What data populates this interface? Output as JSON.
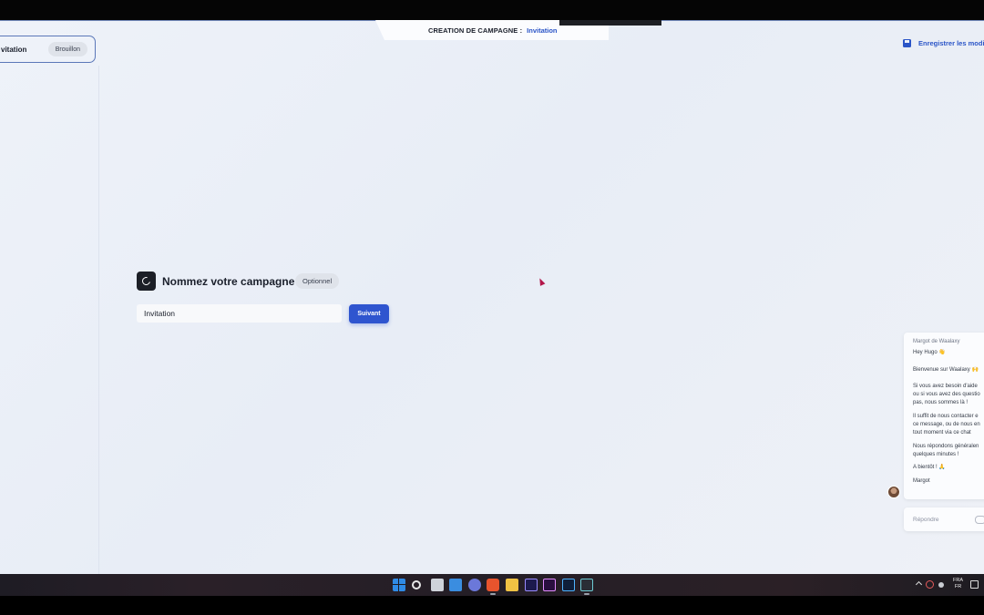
{
  "header": {
    "title_label": "CREATION DE CAMPAGNE :",
    "title_value": "Invitation",
    "save_label": "Enregistrer les modific"
  },
  "sidebar": {
    "campaign_name": "vitation",
    "campaign_status": "Brouillon"
  },
  "main": {
    "heading": "Nommez votre campagne",
    "optional_badge": "Optionnel",
    "name_input_value": "Invitation",
    "next_button": "Suivant"
  },
  "chat": {
    "sender": "Margot de Waalaxy",
    "lines": [
      "Hey Hugo 👋",
      "Bienvenue sur Waalaxy 🙌",
      "Si vous avez besoin d'aide",
      "ou si vous avez des questio",
      "pas, nous sommes là !",
      "Il suffit de nous contacter e",
      "ce message, ou de nous en",
      "tout moment via ce chat",
      "Nous répondons généralen",
      "quelques minutes !",
      "A bientôt ! 🙏",
      "Margot"
    ],
    "reply_placeholder": "Répondre"
  },
  "taskbar": {
    "icons": [
      "windows-start",
      "search",
      "file-explorer",
      "widgets",
      "teams-chat",
      "brave-browser",
      "folder",
      "after-effects",
      "premiere-pro",
      "photoshop",
      "terminal"
    ],
    "lang_top": "FRA",
    "lang_bottom": "FR"
  },
  "colors": {
    "accent": "#2f55cf",
    "link": "#2b55c7",
    "background": "#eef2f9",
    "taskbar": "#231e26"
  }
}
